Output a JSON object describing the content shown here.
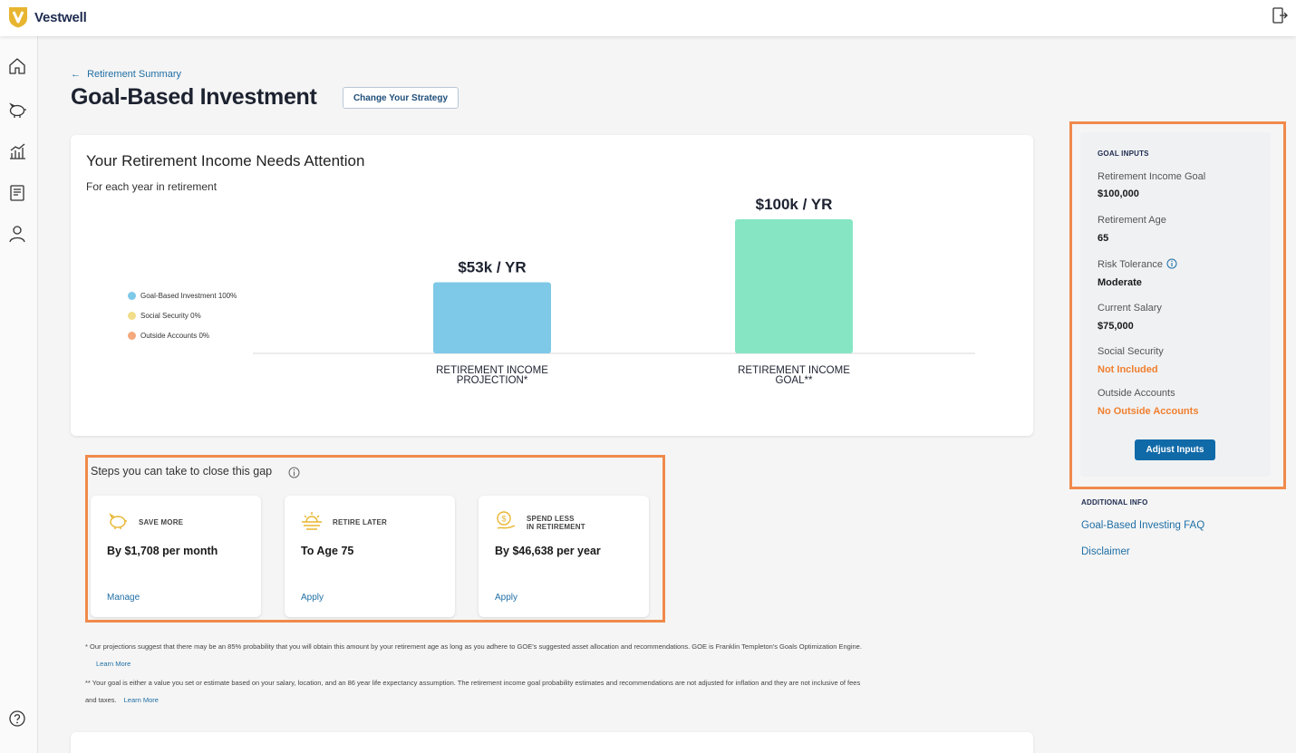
{
  "app": {
    "brand": "Vestwell",
    "brand_color": "#e8b531",
    "accent_color": "#116aa8",
    "highlight_color": "#f08a4b"
  },
  "header": {
    "exit_icon": "sign-out-icon"
  },
  "sidebar": {
    "items": [
      {
        "icon": "home-icon"
      },
      {
        "icon": "piggy-bank-icon"
      },
      {
        "icon": "chart-icon"
      },
      {
        "icon": "document-icon"
      },
      {
        "icon": "user-icon"
      }
    ],
    "help_icon": "help-icon"
  },
  "breadcrumb": {
    "arrow": "←",
    "label": "Retirement Summary"
  },
  "page": {
    "title": "Goal-Based Investment",
    "change_strategy_label": "Change Your Strategy"
  },
  "income_card": {
    "title": "Your Retirement Income Needs Attention",
    "subtitle": "For each year in retirement",
    "legend": [
      {
        "label": "Goal-Based Investment 100%",
        "color": "#7ec8e8"
      },
      {
        "label": "Social Security 0%",
        "color": "#f2dd8a"
      },
      {
        "label": "Outside Accounts 0%",
        "color": "#f4a97c"
      }
    ]
  },
  "chart_data": {
    "type": "bar",
    "categories": [
      "RETIREMENT INCOME PROJECTION*",
      "RETIREMENT INCOME GOAL**"
    ],
    "category_lines": [
      [
        "RETIREMENT INCOME",
        "PROJECTION*"
      ],
      [
        "RETIREMENT INCOME",
        "GOAL**"
      ]
    ],
    "values": [
      53,
      100
    ],
    "value_labels": [
      "$53k / YR",
      "$100k / YR"
    ],
    "colors": [
      "#7ec8e8",
      "#86e6c4"
    ],
    "units": "thousand $ per year",
    "ylim": [
      0,
      100
    ],
    "grid": false,
    "legend_position": "left"
  },
  "steps": {
    "title": "Steps you can take to close this gap",
    "cards": [
      {
        "icon": "piggy-bank-icon",
        "label": [
          "SAVE MORE"
        ],
        "value": "By $1,708 per month",
        "action": "Manage"
      },
      {
        "icon": "sunset-icon",
        "label": [
          "RETIRE LATER"
        ],
        "value": "To Age 75",
        "action": "Apply"
      },
      {
        "icon": "money-hand-icon",
        "label": [
          "SPEND LESS",
          "IN RETIREMENT"
        ],
        "value": "By $46,638 per year",
        "action": "Apply"
      }
    ]
  },
  "footnotes": {
    "fn1": "* Our projections suggest that there may be an 85% probability that you will obtain this amount by your retirement age as long as you adhere to GOE's suggested asset allocation and recommendations. GOE is Franklin Templeton's Goals Optimization Engine.",
    "fn1_link": "Learn More",
    "fn2_line1": "** Your goal is either a value you set or estimate based on your salary, location, and an 86 year life expectancy assumption. The retirement income goal probability estimates and recommendations are not adjusted for inflation and they are not inclusive of fees",
    "fn2_line2": "and taxes.",
    "fn2_link": "Learn More"
  },
  "goal_inputs": {
    "heading": "GOAL INPUTS",
    "items": [
      {
        "label": "Retirement Income Goal",
        "value": "$100,000",
        "orange": false
      },
      {
        "label": "Retirement Age",
        "value": "65",
        "orange": false
      },
      {
        "label": "Risk Tolerance",
        "value": "Moderate",
        "orange": false,
        "info": true
      },
      {
        "label": "Current Salary",
        "value": "$75,000",
        "orange": false
      },
      {
        "label": "Social Security",
        "value": "Not Included",
        "orange": true
      },
      {
        "label": "Outside Accounts",
        "value": "No Outside Accounts",
        "orange": true
      }
    ],
    "adjust_label": "Adjust Inputs"
  },
  "additional_info": {
    "heading": "ADDITIONAL INFO",
    "links": [
      "Goal-Based Investing FAQ",
      "Disclaimer"
    ]
  }
}
